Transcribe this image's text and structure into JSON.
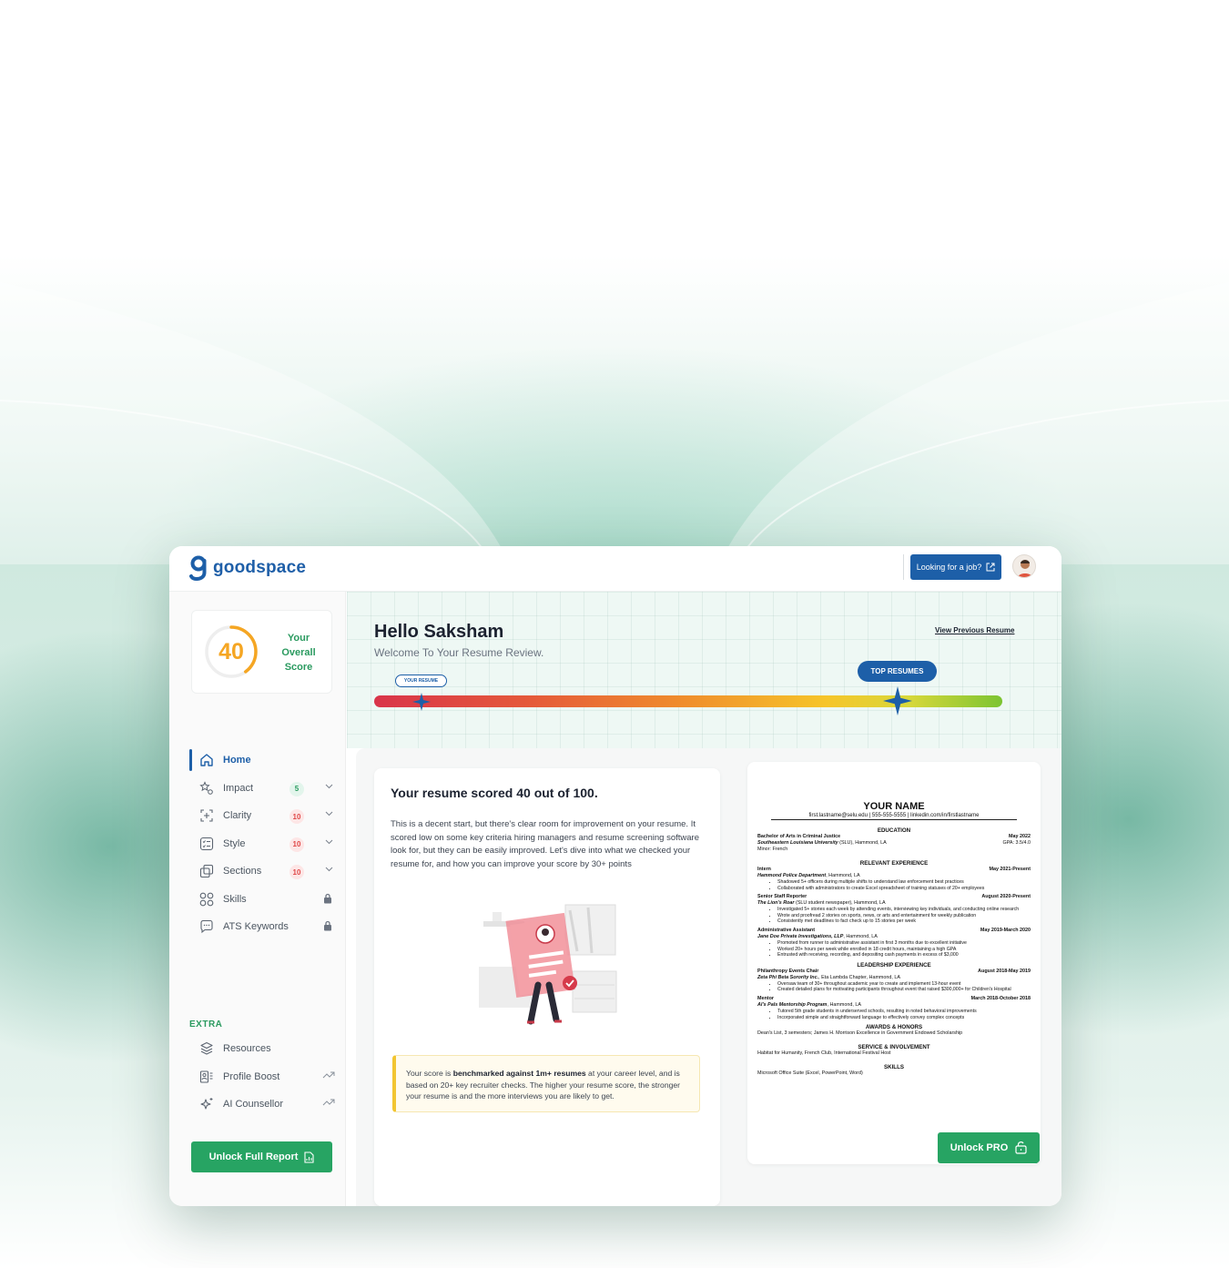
{
  "brand": {
    "name": "goodspace"
  },
  "topbar": {
    "job_button": "Looking for a job?"
  },
  "score": {
    "value": "40",
    "label_line1": "Your",
    "label_line2": "Overall",
    "label_line3": "Score",
    "ring_fraction": 0.4
  },
  "nav": {
    "items": [
      {
        "label": "Home"
      },
      {
        "label": "Impact",
        "badge": "5"
      },
      {
        "label": "Clarity",
        "badge": "10"
      },
      {
        "label": "Style",
        "badge": "10"
      },
      {
        "label": "Sections",
        "badge": "10"
      },
      {
        "label": "Skills"
      },
      {
        "label": "ATS Keywords"
      }
    ],
    "extra_heading": "EXTRA",
    "extra_items": [
      {
        "label": "Resources"
      },
      {
        "label": "Profile Boost"
      },
      {
        "label": "AI Counsellor"
      }
    ],
    "unlock_report": "Unlock Full Report"
  },
  "hero": {
    "greeting": "Hello Saksham",
    "subtitle": "Welcome To Your Resume Review.",
    "view_previous": "View Previous Resume",
    "your_resume_tag": "YOUR RESUME",
    "top_resumes_tag": "TOP RESUMES"
  },
  "summary": {
    "title": "Your resume scored 40 out of 100.",
    "body": "This is a decent start, but there's clear room for improvement on your resume. It scored low on some key criteria hiring managers and resume screening software look for, but they can be easily improved. Let's dive into what we checked your resume for, and how you can improve your score by 30+ points",
    "note_pre": "Your score is ",
    "note_bold": "benchmarked against 1m+ resumes",
    "note_post": " at your career level, and is based on 20+ key recruiter checks. The higher your resume score, the stronger your resume is and the more interviews you are likely to get."
  },
  "resume": {
    "name": "YOUR NAME",
    "contact": "first.lastname@selu.edu | 555-555-5555 | linkedin.com/in/firstlastname",
    "education_h": "EDUCATION",
    "edu_degree": "Bachelor of Arts in Criminal Justice",
    "edu_date": "May 2022",
    "edu_school": "Southeastern Louisiana University",
    "edu_school_rest": " (SLU), Hammond, LA",
    "edu_gpa": "GPA: 3.5/4.0",
    "edu_minor": "Minor: French",
    "relevant_h": "RELEVANT EXPERIENCE",
    "intern_title": "Intern",
    "intern_date": "May 2021-Present",
    "intern_org": "Hammond Police Department",
    "intern_org_rest": ", Hammond, LA",
    "intern_b1": "Shadowed 5+ officers during multiple shifts to understand law enforcement best practices",
    "intern_b2": "Collaborated with administrators to create Excel spreadsheet of training statuses of 20+ employees",
    "ssr_title": "Senior Staff Reporter",
    "ssr_date": "August 2020-Present",
    "ssr_org": "The Lion's Roar",
    "ssr_org_rest": " (SLU student newspaper), Hammond, LA",
    "ssr_b1": "Investigated 5+ stories each week by attending events, interviewing key individuals, and conducting online research",
    "ssr_b2": "Wrote and proofread 2 stories on sports, news, or arts and entertainment for weekly publication",
    "ssr_b3": "Consistently met deadlines to fact check up to 15 stories per week",
    "aa_title": "Administrative Assistant",
    "aa_date": "May 2019-March 2020",
    "aa_org": "Jane Doe Private Investigations, LLP",
    "aa_org_rest": ", Hammond, LA",
    "aa_b1": "Promoted from runner to administrative assistant in first 3 months due to excellent initiative",
    "aa_b2": "Worked 20+ hours per week while enrolled in 18 credit hours, maintaining a high GPA",
    "aa_b3": "Entrusted with receiving, recording, and depositing cash payments in excess of $3,000",
    "leadership_h": "LEADERSHIP EXPERIENCE",
    "pec_title": "Philanthropy Events Chair",
    "pec_date": "August 2018-May 2019",
    "pec_org": "Zeta Phi Beta Sorority Inc.",
    "pec_org_rest": ", Eta Lambda Chapter, Hammond, LA",
    "pec_b1": "Oversaw team of 30+ throughout academic year to create and implement 13-hour event",
    "pec_b2": "Created detailed plans for motivating participants throughout event that raised $300,000+ for Children's Hospital",
    "mentor_title": "Mentor",
    "mentor_date": "March 2018-October 2018",
    "mentor_org": "Al's Pals Mentorship Program",
    "mentor_org_rest": ", Hammond, LA",
    "mentor_b1": "Tutored 5th grade students in underserved schools, resulting in noted behavioral improvements",
    "mentor_b2": "Incorporated simple and straightforward language to effectively convey complex concepts",
    "awards_h": "AWARDS & HONORS",
    "awards_text": "Dean's List, 3 semesters; James H. Morrison Excellence in Government Endowed Scholarship",
    "service_h": "SERVICE & INVOLVEMENT",
    "service_text": "Habitat for Humanity, French Club, International Festival Host",
    "skills_h": "SKILLS",
    "skills_text": "Microsoft Office Suite (Excel, PowerPoint, Word)"
  },
  "unlock_pro": "Unlock PRO",
  "colors": {
    "brand_blue": "#1d5fa8",
    "brand_green": "#27a463",
    "score_orange": "#f5a623"
  }
}
